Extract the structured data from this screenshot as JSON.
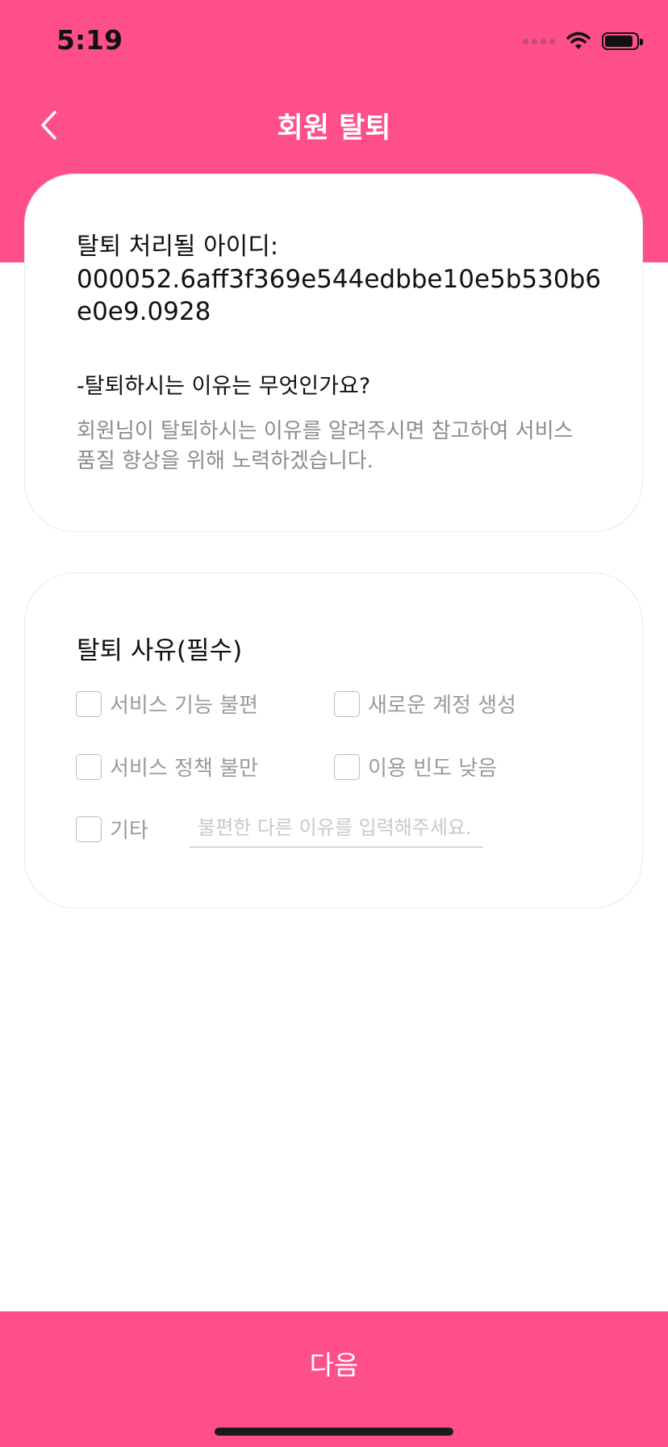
{
  "status_bar": {
    "time": "5:19"
  },
  "header": {
    "title": "회원 탈퇴"
  },
  "account_card": {
    "id_label": "탈퇴 처리될 아이디:",
    "id_value": "000052.6aff3f369e544edbbe10e5b530b6e0e9.0928",
    "question": "-탈퇴하시는 이유는 무엇인가요?",
    "description": "회원님이 탈퇴하시는 이유를 알려주시면 참고하여 서비스 품질 향상을 위해 노력하겠습니다."
  },
  "reason_card": {
    "title": "탈퇴 사유(필수)",
    "options": [
      "서비스 기능 불편",
      "새로운 계정 생성",
      "서비스 정책 불만",
      "이용 빈도 낮음",
      "기타"
    ],
    "other_placeholder": "불편한 다른 이유를 입력해주세요."
  },
  "footer": {
    "next_label": "다음"
  },
  "colors": {
    "accent": "#FF4F8B"
  }
}
